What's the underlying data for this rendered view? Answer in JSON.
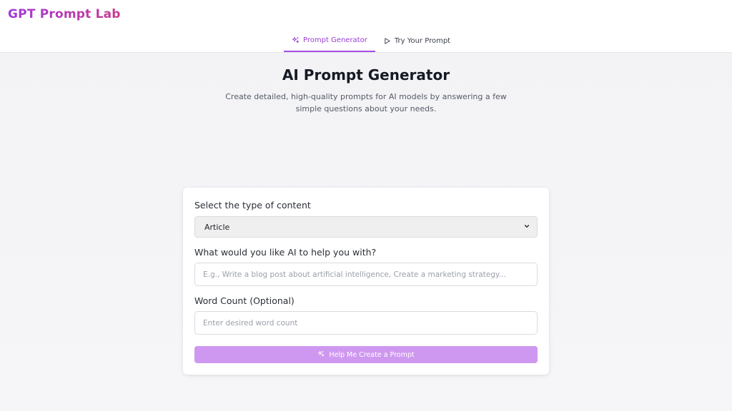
{
  "app": {
    "brand": "GPT Prompt Lab"
  },
  "nav": {
    "tabs": [
      {
        "label": "Prompt Generator",
        "icon": "sparkles-icon",
        "active": true
      },
      {
        "label": "Try Your Prompt",
        "icon": "play-icon",
        "active": false
      }
    ]
  },
  "header": {
    "title": "AI Prompt Generator",
    "subtitle": "Create detailed, high-quality prompts for AI models by answering a few simple questions about your needs."
  },
  "form": {
    "content_type": {
      "label": "Select the type of content",
      "value": "Article"
    },
    "task": {
      "label": "What would you like AI to help you with?",
      "placeholder": "E.g., Write a blog post about artificial intelligence, Create a marketing strategy..."
    },
    "word_count": {
      "label": "Word Count (Optional)",
      "placeholder": "Enter desired word count"
    },
    "submit_label": "Help Me Create a Prompt"
  },
  "colors": {
    "accent": "#a24ee0",
    "button": "#cf98f0",
    "brand_gradient_start": "#a23ad8",
    "brand_gradient_end": "#c9388f"
  }
}
